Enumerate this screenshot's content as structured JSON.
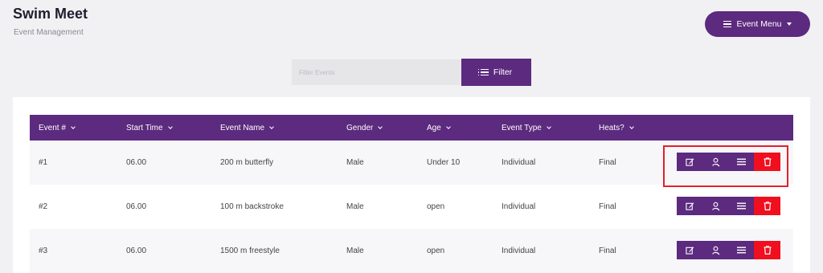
{
  "header": {
    "title": "Swim Meet",
    "subtitle": "Event Management",
    "menu_button_label": "Event Menu"
  },
  "filter": {
    "placeholder": "Filter Events",
    "value": "",
    "button_label": "Filter"
  },
  "table": {
    "columns": [
      "Event #",
      "Start Time",
      "Event Name",
      "Gender",
      "Age",
      "Event Type",
      "Heats?"
    ],
    "rows": [
      [
        "#1",
        "06.00",
        "200 m butterfly",
        "Male",
        "Under 10",
        "Individual",
        "Final"
      ],
      [
        "#2",
        "06.00",
        "100 m backstroke",
        "Male",
        "open",
        "Individual",
        "Final"
      ],
      [
        "#3",
        "06.00",
        "1500 m freestyle",
        "Male",
        "open",
        "Individual",
        "Final"
      ]
    ],
    "row_actions": [
      "edit-icon",
      "swimmer-icon",
      "list-icon",
      "trash-icon"
    ]
  },
  "colors": {
    "accent": "#5c2a7e",
    "danger": "#f00f1e",
    "highlight": "#e3202c",
    "background": "#f1f1f4"
  }
}
